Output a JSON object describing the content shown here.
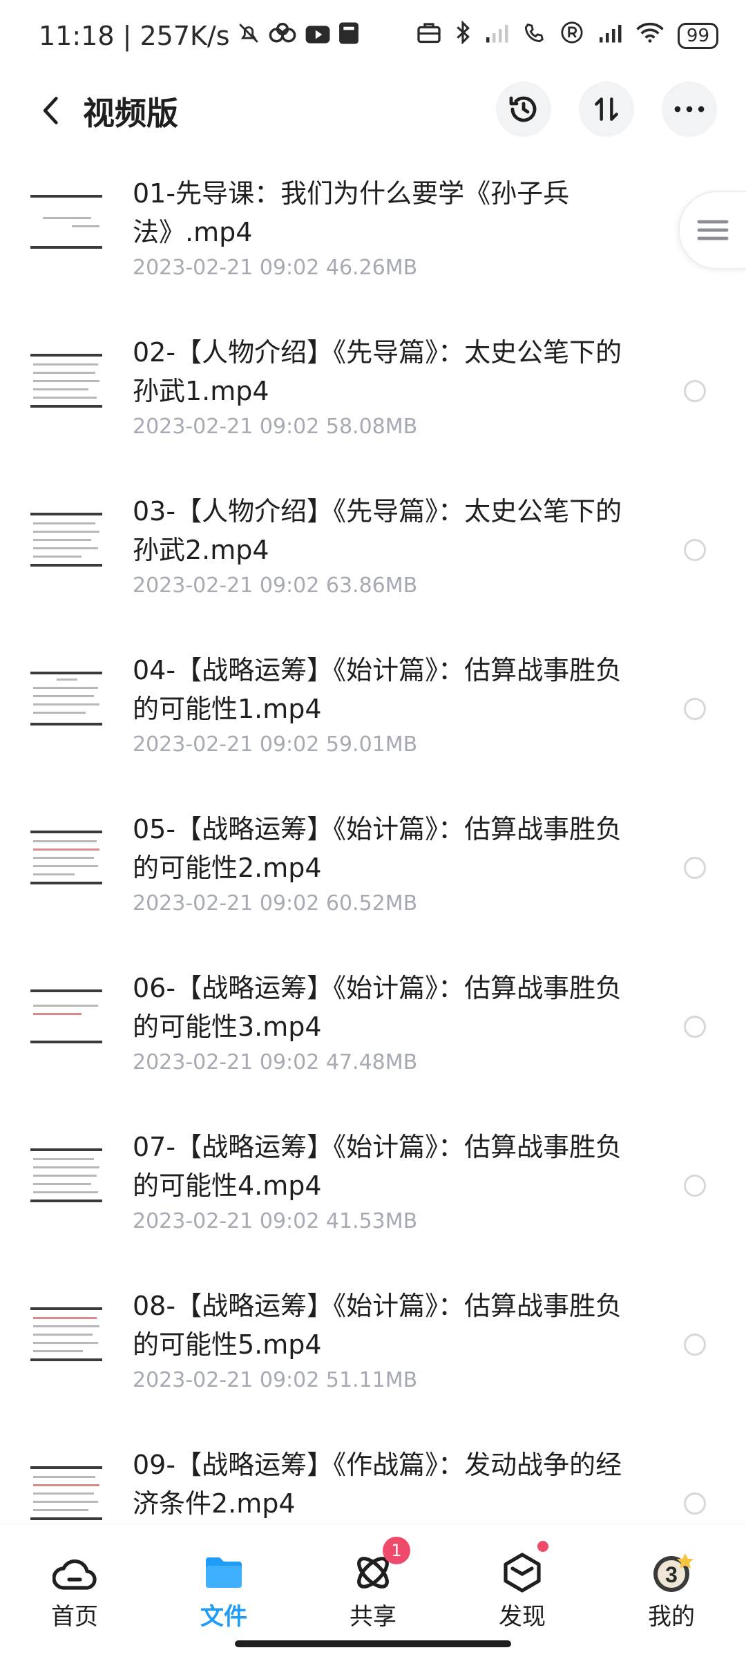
{
  "status_bar": {
    "time_speed": "11:18 | 257K/s",
    "battery": "99"
  },
  "header": {
    "title": "视频版"
  },
  "files": [
    {
      "name": "01-先导课：我们为什么要学《孙子兵法》.mp4",
      "meta": "2023-02-21  09:02  46.26MB"
    },
    {
      "name": "02-【人物介绍】《先导篇》：太史公笔下的孙武1.mp4",
      "meta": "2023-02-21  09:02  58.08MB"
    },
    {
      "name": "03-【人物介绍】《先导篇》：太史公笔下的孙武2.mp4",
      "meta": "2023-02-21  09:02  63.86MB"
    },
    {
      "name": "04-【战略运筹】《始计篇》：估算战事胜负的可能性1.mp4",
      "meta": "2023-02-21  09:02  59.01MB"
    },
    {
      "name": "05-【战略运筹】《始计篇》：估算战事胜负的可能性2.mp4",
      "meta": "2023-02-21  09:02  60.52MB"
    },
    {
      "name": "06-【战略运筹】《始计篇》：估算战事胜负的可能性3.mp4",
      "meta": "2023-02-21  09:02  47.48MB"
    },
    {
      "name": "07-【战略运筹】《始计篇》：估算战事胜负的可能性4.mp4",
      "meta": "2023-02-21  09:02  41.53MB"
    },
    {
      "name": "08-【战略运筹】《始计篇》：估算战事胜负的可能性5.mp4",
      "meta": "2023-02-21  09:02  51.11MB"
    },
    {
      "name": "09-【战略运筹】《作战篇》：发动战争的经济条件2.mp4",
      "meta": ""
    }
  ],
  "bottom_nav": {
    "home": "首页",
    "files": "文件",
    "share": "共享",
    "share_badge": "1",
    "discover": "发现",
    "mine": "我的"
  },
  "colors": {
    "accent": "#1f9cf5",
    "badge": "#f04a6a",
    "meta_text": "#a6aab4"
  }
}
